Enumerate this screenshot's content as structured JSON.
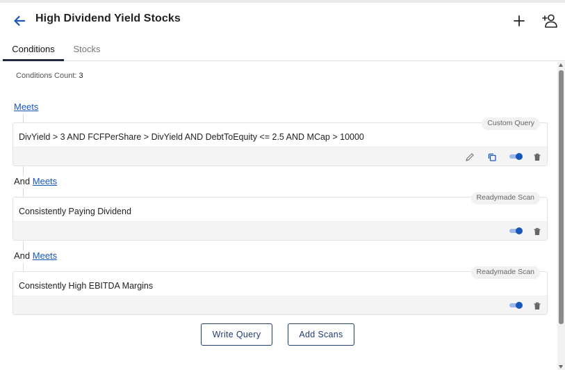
{
  "header": {
    "title": "High Dividend Yield Stocks",
    "back_icon": "arrow-left-icon",
    "add_icon": "plus-icon",
    "share_icon": "add-person-icon"
  },
  "tabs": [
    {
      "label": "Conditions",
      "active": true
    },
    {
      "label": "Stocks",
      "active": false
    }
  ],
  "conditions": {
    "count_label": "Conditions Count:",
    "count_value": "3",
    "items": [
      {
        "connector": "",
        "link_label": "Meets",
        "badge": "Custom Query",
        "text": "DivYield > 3 AND FCFPerShare > DivYield AND DebtToEquity <= 2.5 AND MCap > 10000",
        "enabled": true
      },
      {
        "connector": "And",
        "link_label": "Meets",
        "badge": "Readymade Scan",
        "text": "Consistently Paying Dividend",
        "enabled": true
      },
      {
        "connector": "And",
        "link_label": "Meets",
        "badge": "Readymade Scan",
        "text": "Consistently High EBITDA Margins",
        "enabled": true
      }
    ]
  },
  "actions": {
    "write_query": "Write Query",
    "add_scans": "Add Scans"
  },
  "colors": {
    "accent": "#1a56b8",
    "button_border": "#1f3c6e",
    "toggle_track": "#9bb9ea"
  }
}
